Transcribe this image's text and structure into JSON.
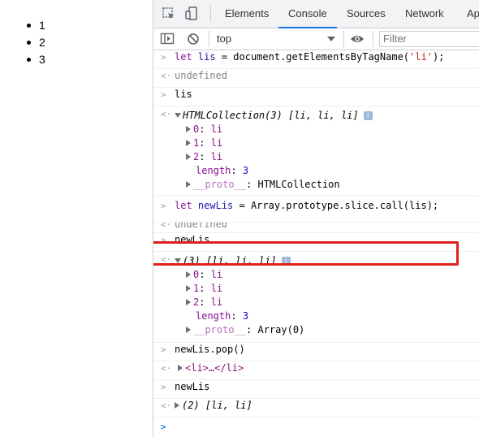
{
  "page_list": [
    "1",
    "2",
    "3"
  ],
  "tabs": [
    {
      "label": "Elements",
      "active": false
    },
    {
      "label": "Console",
      "active": true
    },
    {
      "label": "Sources",
      "active": false
    },
    {
      "label": "Network",
      "active": false
    },
    {
      "label": "Ap",
      "active": false
    }
  ],
  "toolbar": {
    "context_value": "top",
    "filter_placeholder": "Filter"
  },
  "console": {
    "cmd1": {
      "keyword": "let",
      "var": "lis",
      "rest_a": " = document.getElementsByTagName(",
      "str": "'li'",
      "rest_b": ");"
    },
    "res1": "undefined",
    "cmd2": "lis",
    "coll_header": "HTMLCollection(3) [li, li, li]",
    "coll_items": [
      {
        "key": "0",
        "val": "li"
      },
      {
        "key": "1",
        "val": "li"
      },
      {
        "key": "2",
        "val": "li"
      }
    ],
    "coll_length_key": "length",
    "coll_length_val": "3",
    "coll_proto_key": "__proto__",
    "coll_proto_val": "HTMLCollection",
    "cmd3": {
      "keyword": "let",
      "var": "newLis",
      "rest": " = Array.prototype.slice.call(lis);"
    },
    "res3": "undefined",
    "cmd4": "newLis",
    "arr_header": "(3) [li, li, li]",
    "arr_items": [
      {
        "key": "0",
        "val": "li"
      },
      {
        "key": "1",
        "val": "li"
      },
      {
        "key": "2",
        "val": "li"
      }
    ],
    "arr_length_key": "length",
    "arr_length_val": "3",
    "arr_proto_key": "__proto__",
    "arr_proto_val": "Array(0)",
    "cmd5": "newLis.pop()",
    "res5": "<li>…</li>",
    "cmd6": "newLis",
    "res6": "(2) [li, li]",
    "info_icon": "i"
  },
  "colors": {
    "accent": "#1a73e8",
    "highlight": "#e0201b"
  }
}
